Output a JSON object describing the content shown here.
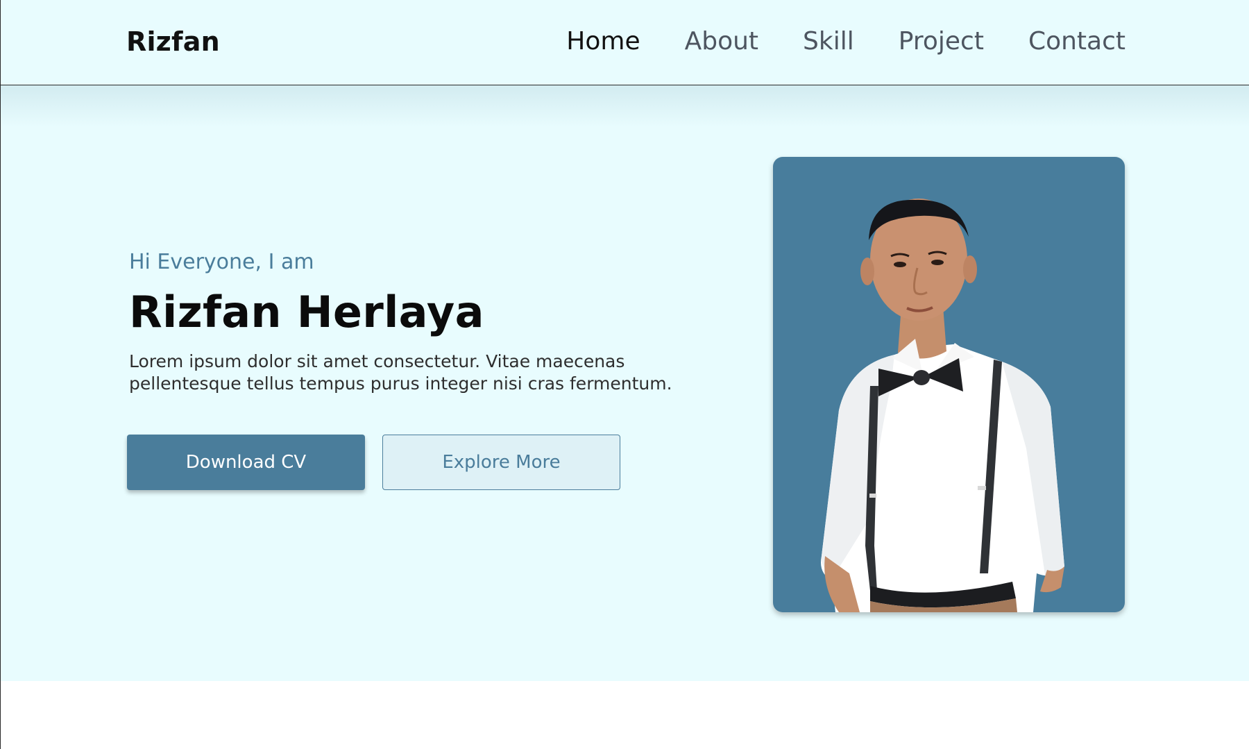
{
  "header": {
    "brand": "Rizfan",
    "nav": [
      {
        "label": "Home",
        "active": true
      },
      {
        "label": "About",
        "active": false
      },
      {
        "label": "Skill",
        "active": false
      },
      {
        "label": "Project",
        "active": false
      },
      {
        "label": "Contact",
        "active": false
      }
    ]
  },
  "hero": {
    "greeting": "Hi Everyone, I am",
    "name": "Rizfan Herlaya",
    "description": "Lorem ipsum dolor sit amet consectetur. Vitae maecenas pellentesque tellus tempus purus integer nisi cras fermentum.",
    "primary_button": "Download CV",
    "secondary_button": "Explore More"
  },
  "colors": {
    "background": "#e8fcfe",
    "accent": "#4a7d9b",
    "photo_background": "#487d9c",
    "text_dark": "#111111"
  }
}
